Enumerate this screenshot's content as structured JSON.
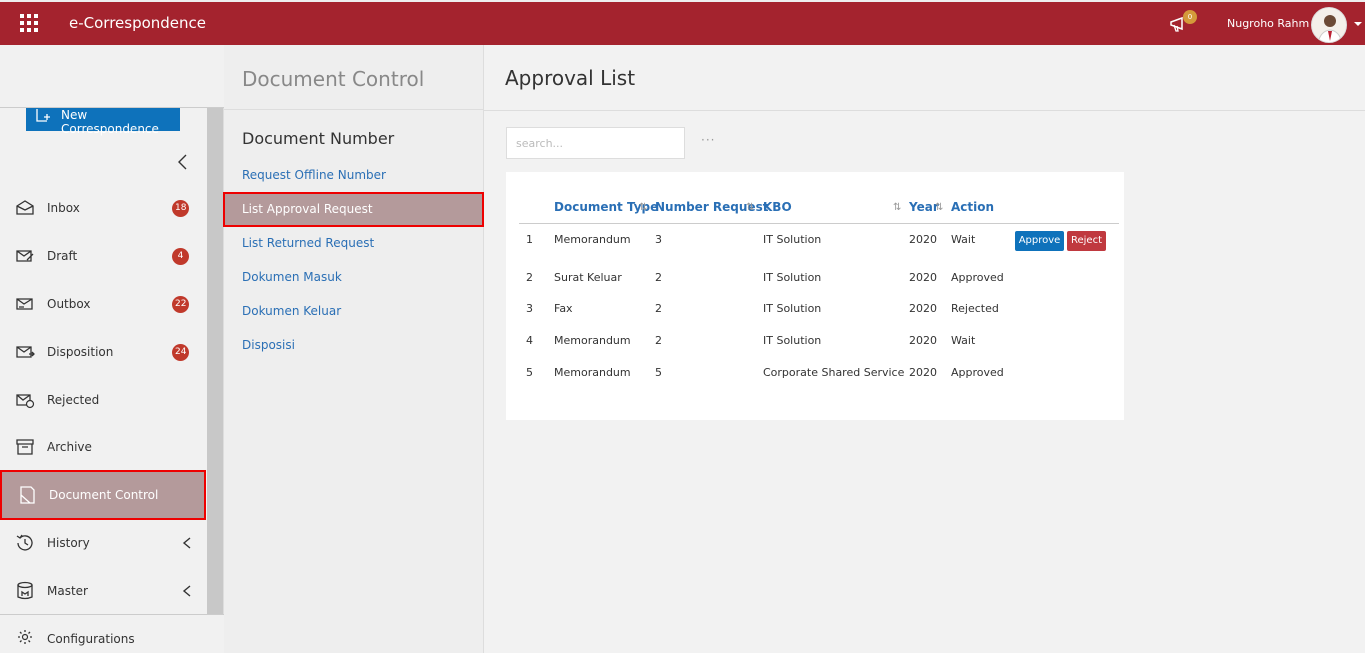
{
  "header": {
    "app_title": "e-Correspondence",
    "notification_count": "0",
    "user_name": "Nugroho Rahm"
  },
  "sidebar": {
    "new_button_label": "New Correspondence",
    "items": [
      {
        "label": "Inbox",
        "badge": "18",
        "icon": "inbox-icon"
      },
      {
        "label": "Draft",
        "badge": "4",
        "icon": "draft-icon"
      },
      {
        "label": "Outbox",
        "badge": "22",
        "icon": "outbox-icon"
      },
      {
        "label": "Disposition",
        "badge": "24",
        "icon": "disposition-icon"
      },
      {
        "label": "Rejected",
        "icon": "rejected-icon"
      },
      {
        "label": "Archive",
        "icon": "archive-icon"
      },
      {
        "label": "Document Control",
        "icon": "document-control-icon",
        "active": true
      },
      {
        "label": "History",
        "icon": "history-icon"
      },
      {
        "label": "Master",
        "icon": "master-icon"
      }
    ],
    "configurations_label": "Configurations"
  },
  "middle": {
    "title": "Document Control",
    "subtitle": "Document Number",
    "links": [
      "Request Offline Number",
      "List Approval Request",
      "List Returned Request",
      "Dokumen Masuk",
      "Dokumen Keluar",
      "Disposisi"
    ]
  },
  "main": {
    "title": "Approval List",
    "search_placeholder": "search...",
    "more_label": "···",
    "table": {
      "headers": [
        "Document Type",
        "Number Request",
        "KBO",
        "Year",
        "Action"
      ],
      "rows": [
        {
          "no": "1",
          "type": "Memorandum",
          "number": "3",
          "kbo": "IT Solution",
          "year": "2020",
          "status": "Wait"
        },
        {
          "no": "2",
          "type": "Surat Keluar",
          "number": "2",
          "kbo": "IT Solution",
          "year": "2020",
          "status": "Approved"
        },
        {
          "no": "3",
          "type": "Fax",
          "number": "2",
          "kbo": "IT Solution",
          "year": "2020",
          "status": "Rejected"
        },
        {
          "no": "4",
          "type": "Memorandum",
          "number": "2",
          "kbo": "IT Solution",
          "year": "2020",
          "status": "Wait"
        },
        {
          "no": "5",
          "type": "Memorandum",
          "number": "5",
          "kbo": "Corporate Shared Service",
          "year": "2020",
          "status": "Approved"
        }
      ],
      "approve_label": "Approve",
      "reject_label": "Reject"
    }
  },
  "colors": {
    "brand": "#a4232e",
    "primary": "#0e72bb",
    "danger": "#c0393f",
    "link": "#2a6fb5"
  }
}
